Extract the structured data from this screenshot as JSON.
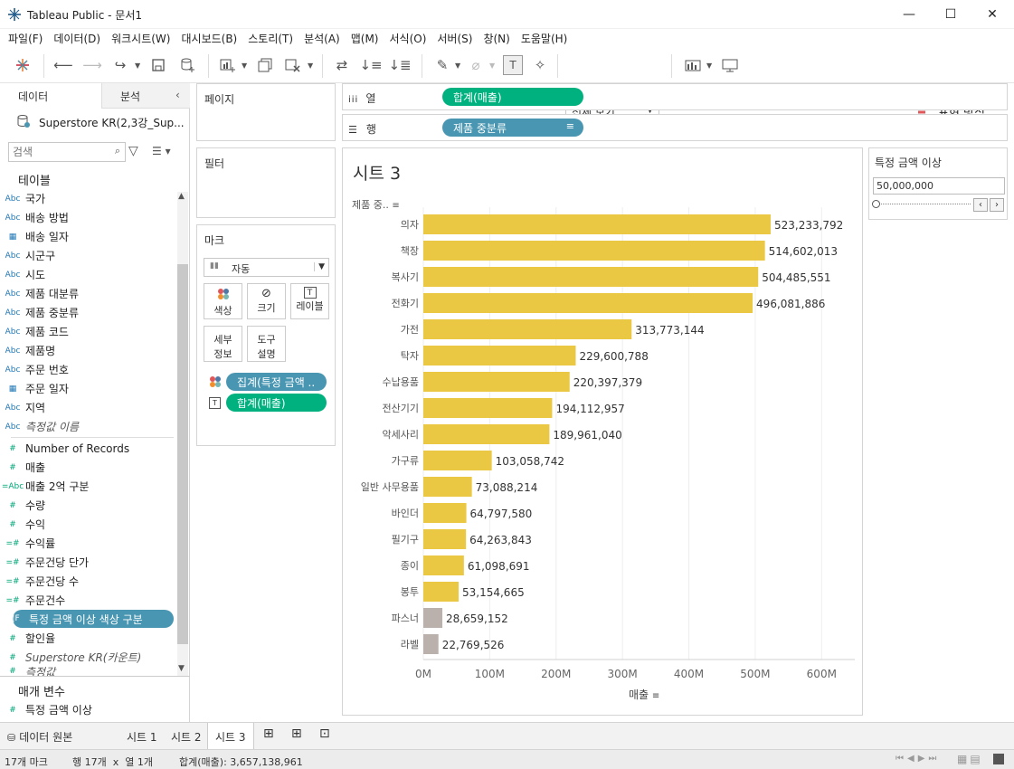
{
  "window": {
    "title": "Tableau Public - 문서1",
    "minimize": "—",
    "maximize": "☐",
    "close": "✕"
  },
  "menu": [
    "파일(F)",
    "데이터(D)",
    "워크시트(W)",
    "대시보드(B)",
    "스토리(T)",
    "분석(A)",
    "맵(M)",
    "서식(O)",
    "서버(S)",
    "창(N)",
    "도움말(H)"
  ],
  "toolbar": {
    "fit": "전체 보기",
    "show_me": "표현 방식"
  },
  "left_panel": {
    "tab_data": "데이터",
    "tab_analysis": "분석",
    "datasource": "Superstore KR(2,3강_Sup...",
    "search_placeholder": "검색",
    "tables_header": "테이블",
    "fields": [
      {
        "icon": "Abc",
        "name": "국가"
      },
      {
        "icon": "▭",
        "name": "배송 방법"
      },
      {
        "icon": "📅",
        "name": "배송 일자"
      },
      {
        "icon": "Abc",
        "name": "시군구"
      },
      {
        "icon": "Abc",
        "name": "시도"
      },
      {
        "icon": "Abc",
        "name": "제품 대분류"
      },
      {
        "icon": "Abc",
        "name": "제품 중분류"
      },
      {
        "icon": "Abc",
        "name": "제품 코드"
      },
      {
        "icon": "Abc",
        "name": "제품명"
      },
      {
        "icon": "Abc",
        "name": "주문 번호"
      },
      {
        "icon": "📅",
        "name": "주문 일자"
      },
      {
        "icon": "Abc",
        "name": "지역"
      },
      {
        "icon": "Abc",
        "name": "측정값 이름"
      }
    ],
    "measures": [
      {
        "icon": "#",
        "name": "Number of Records"
      },
      {
        "icon": "#",
        "name": "매출"
      },
      {
        "icon": "=Abc",
        "name": "매출 2억 구분"
      },
      {
        "icon": "#",
        "name": "수량"
      },
      {
        "icon": "#",
        "name": "수익"
      },
      {
        "icon": "=#",
        "name": "수익률"
      },
      {
        "icon": "=#",
        "name": "주문건당 단가"
      },
      {
        "icon": "=#",
        "name": "주문건당 수"
      },
      {
        "icon": "=#",
        "name": "주문건수"
      },
      {
        "icon": "=T|F",
        "name": "특정 금액 이상 색상 구분"
      },
      {
        "icon": "#",
        "name": "할인율"
      },
      {
        "icon": "#",
        "name": "Superstore KR(카운트)"
      },
      {
        "icon": "#",
        "name": "측정값"
      }
    ],
    "params_header": "매개 변수",
    "params": [
      {
        "icon": "#",
        "name": "특정 금액 이상"
      }
    ]
  },
  "pages_card": {
    "title": "페이지"
  },
  "filters_card": {
    "title": "필터"
  },
  "marks_card": {
    "title": "마크",
    "type": "자동",
    "buttons": {
      "color": "색상",
      "size": "크기",
      "label": "레이블",
      "detail_line1": "세부",
      "detail_line2": "정보",
      "tooltip_line1": "도구",
      "tooltip_line2": "설명"
    },
    "pill_color": "집계(특정 금액 ..",
    "pill_label": "합계(매출)"
  },
  "shelves": {
    "columns_label": "열",
    "columns_pill": "합계(매출)",
    "rows_label": "행",
    "rows_pill": "제품 중분류"
  },
  "sheet": {
    "title": "시트 3",
    "row_header": "제품 중..",
    "axis_label": "매출"
  },
  "chart_data": {
    "type": "bar",
    "orientation": "horizontal",
    "categories": [
      "의자",
      "책장",
      "복사기",
      "전화기",
      "가전",
      "탁자",
      "수납용품",
      "전산기기",
      "악세사리",
      "가구류",
      "일반 사무용품",
      "바인더",
      "필기구",
      "종이",
      "봉투",
      "파스너",
      "라벨"
    ],
    "values": [
      523233792,
      514602013,
      504485551,
      496081886,
      313773144,
      229600788,
      220397379,
      194112957,
      189961040,
      103058742,
      73088214,
      64797580,
      64263843,
      61098691,
      53154665,
      28659152,
      22769526
    ],
    "labels": [
      "523,233,792",
      "514,602,013",
      "504,485,551",
      "496,081,886",
      "313,773,144",
      "229,600,788",
      "220,397,379",
      "194,112,957",
      "189,961,040",
      "103,058,742",
      "73,088,214",
      "64,797,580",
      "64,263,843",
      "61,098,691",
      "53,154,665",
      "28,659,152",
      "22,769,526"
    ],
    "threshold": 50000000,
    "color_above": "#ebc844",
    "color_below": "#bab0ac",
    "xlim": [
      0,
      650000000
    ],
    "xticks": [
      0,
      100000000,
      200000000,
      300000000,
      400000000,
      500000000,
      600000000
    ],
    "xtick_labels": [
      "0M",
      "100M",
      "200M",
      "300M",
      "400M",
      "500M",
      "600M"
    ],
    "xlabel": "매출"
  },
  "parameter": {
    "title": "특정 금액 이상",
    "value": "50,000,000"
  },
  "tabs": {
    "datasource": "데이터 원본",
    "sheets": [
      "시트 1",
      "시트 2",
      "시트 3"
    ]
  },
  "status": {
    "marks": "17개 마크",
    "rows_cols": "행 17개  x  열 1개",
    "sum": "합계(매출): 3,657,138,961"
  }
}
